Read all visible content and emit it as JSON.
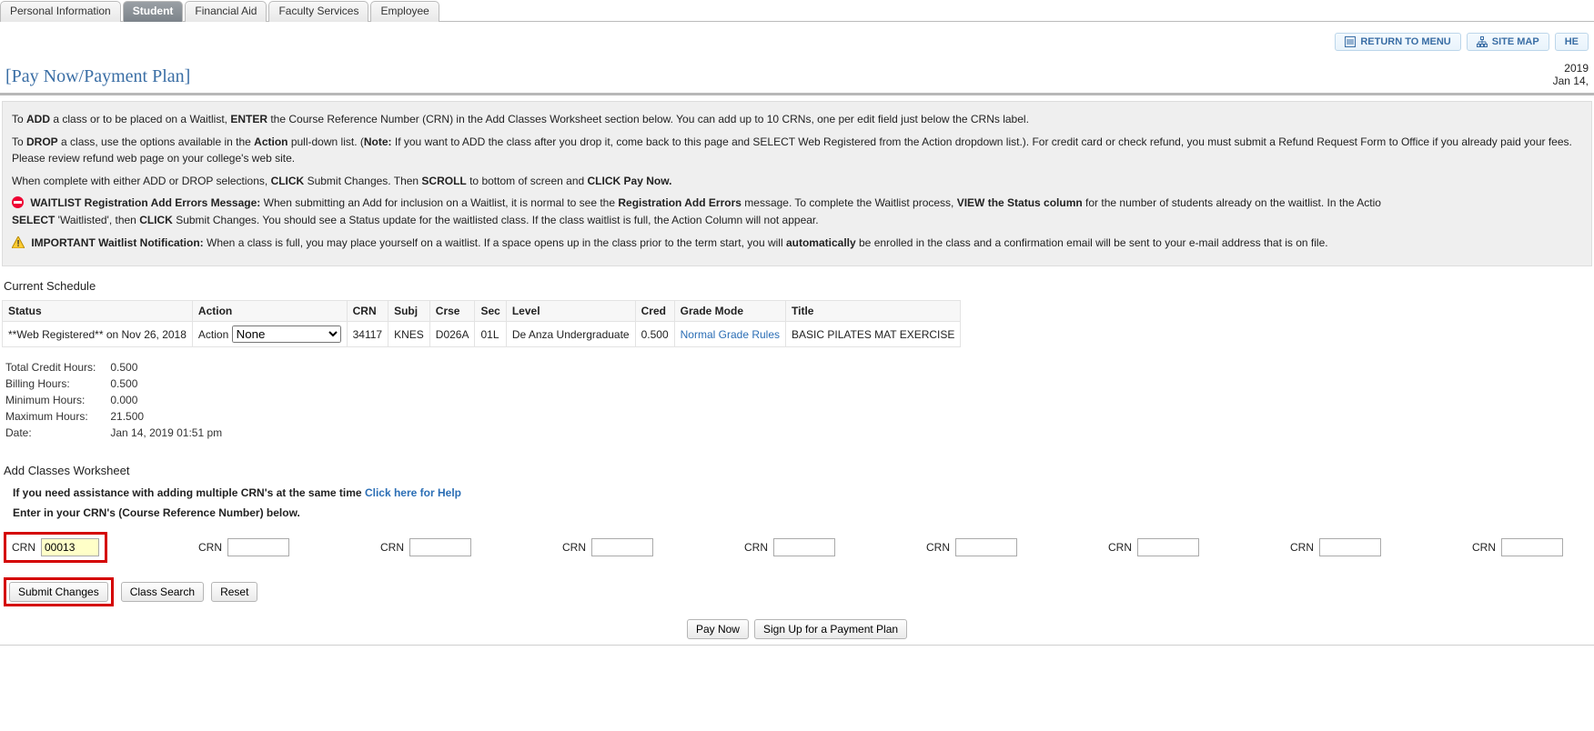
{
  "tabs": [
    "Personal Information",
    "Student",
    "Financial Aid",
    "Faculty Services",
    "Employee"
  ],
  "active_tab_index": 1,
  "toolbar": {
    "return_label": "RETURN TO MENU",
    "sitemap_label": "SITE MAP",
    "help_label": "HE"
  },
  "page_title": "[Pay Now/Payment Plan]",
  "term": "2019",
  "date_display": "Jan 14,",
  "instructions": {
    "p1_a": "To ",
    "p1_b": "ADD",
    "p1_c": " a class or to be placed on a Waitlist, ",
    "p1_d": "ENTER",
    "p1_e": " the Course Reference Number (CRN) in the Add Classes Worksheet section below. You can add up to 10 CRNs, one per edit field just below the CRNs label.",
    "p2_a": "To ",
    "p2_b": "DROP",
    "p2_c": " a class, use the options available in the ",
    "p2_d": "Action",
    "p2_e": " pull-down list. (",
    "p2_f": "Note:",
    "p2_g": " If you want to ADD the class after you drop it, come back to this page and SELECT Web Registered from the Action dropdown list.). For credit card or check refund, you must submit a Refund Request Form to Office if you already paid your fees. Please review refund web page on your college's web site.",
    "p3_a": "When complete with either ADD or DROP selections, ",
    "p3_b": "CLICK",
    "p3_c": " Submit Changes. Then ",
    "p3_d": "SCROLL",
    "p3_e": " to bottom of screen and ",
    "p3_f": "CLICK Pay Now.",
    "p4_a": "WAITLIST Registration Add Errors Message:",
    "p4_b": " When submitting an Add for inclusion on a Waitlist, it is normal to see the ",
    "p4_c": "Registration Add Errors",
    "p4_d": " message. To complete the Waitlist process, ",
    "p4_e": "VIEW the Status column",
    "p4_f": " for the number of students already on the waitlist. In the Actio",
    "p4_g": "SELECT",
    "p4_h": " 'Waitlisted', then ",
    "p4_i": "CLICK",
    "p4_j": " Submit Changes. You should see a Status update for the waitlisted class. If the class waitlist is full, the Action Column will not appear.",
    "p5_a": "IMPORTANT Waitlist Notification:",
    "p5_b": " When a class is full, you may place yourself on a waitlist. If a space opens up in the class prior to the term start, you will ",
    "p5_c": "automatically",
    "p5_d": " be enrolled in the class and a confirmation email will be sent to your e-mail address that is on file."
  },
  "current_schedule_title": "Current Schedule",
  "sched_headers": [
    "Status",
    "Action",
    "CRN",
    "Subj",
    "Crse",
    "Sec",
    "Level",
    "Cred",
    "Grade Mode",
    "Title"
  ],
  "sched_row": {
    "status": "**Web Registered** on Nov 26, 2018",
    "action_label": "Action",
    "action_selected": "None",
    "crn": "34117",
    "subj": "KNES",
    "crse": "D026A",
    "sec": "01L",
    "level": "De Anza Undergraduate",
    "cred": "0.500",
    "grade_mode": "Normal Grade Rules",
    "title": "BASIC PILATES MAT EXERCISE"
  },
  "summary": {
    "rows": [
      [
        "Total Credit Hours:",
        "0.500"
      ],
      [
        "Billing Hours:",
        "0.500"
      ],
      [
        "Minimum Hours:",
        "0.000"
      ],
      [
        "Maximum Hours:",
        "21.500"
      ],
      [
        "Date:",
        "Jan 14, 2019 01:51 pm"
      ]
    ]
  },
  "worksheet_title": "Add Classes Worksheet",
  "assist_text": "If you need assistance with adding multiple CRN's at the same time ",
  "assist_link": "Click here for Help",
  "enter_text": "Enter in your CRN's (Course Reference Number) below.",
  "crn_label": "CRN",
  "crn_first_value": "00013",
  "crn_rest_count": 9,
  "buttons": {
    "submit": "Submit Changes",
    "class_search": "Class Search",
    "reset": "Reset",
    "pay_now": "Pay Now",
    "signup": "Sign Up for a Payment Plan"
  }
}
